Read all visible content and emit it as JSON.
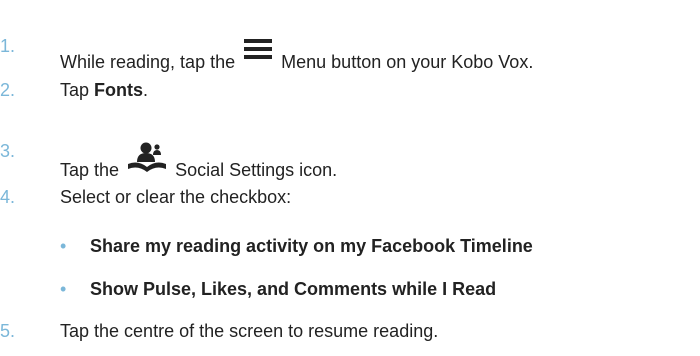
{
  "steps": [
    {
      "num": "1.",
      "pre": "While reading, tap the",
      "icon": "menu-icon",
      "post": "Menu button on your Kobo Vox."
    },
    {
      "num": "2.",
      "pre": "Tap",
      "bold": "Fonts",
      "post": "."
    },
    {
      "num": "3.",
      "pre": "Tap the",
      "icon": "social-settings-icon",
      "post": "Social Settings icon."
    },
    {
      "num": "4.",
      "text": "Select or clear the checkbox:"
    },
    {
      "num": "5.",
      "text": "Tap the centre of the screen to resume reading."
    }
  ],
  "bullets": [
    "Share my reading activity on my Facebook Timeline",
    "Show Pulse, Likes, and Comments while I Read"
  ],
  "colors": {
    "number": "#7bb7d9",
    "text": "#222222",
    "icon": "#222222"
  }
}
